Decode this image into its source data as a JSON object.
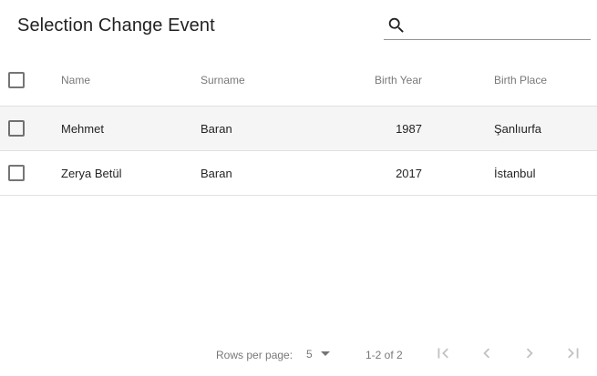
{
  "toolbar": {
    "title": "Selection Change Event",
    "search_placeholder": "",
    "search_value": ""
  },
  "table": {
    "columns": {
      "name": "Name",
      "surname": "Surname",
      "birth_year": "Birth Year",
      "birth_place": "Birth Place"
    },
    "rows": [
      {
        "name": "Mehmet",
        "surname": "Baran",
        "birth_year": "1987",
        "birth_place": "Şanlıurfa",
        "checked": false
      },
      {
        "name": "Zerya Betül",
        "surname": "Baran",
        "birth_year": "2017",
        "birth_place": "İstanbul",
        "checked": false
      }
    ]
  },
  "pagination": {
    "rows_per_page_label": "Rows per page:",
    "rows_per_page_value": "5",
    "range_label": "1-2 of 2",
    "buttons": [
      "first-page-icon",
      "previous-page-icon",
      "next-page-icon",
      "last-page-icon"
    ]
  },
  "colors": {
    "row_shade": "#f5f5f5",
    "divider": "#e0e0e0",
    "icon_disabled": "#c2c2c2"
  }
}
